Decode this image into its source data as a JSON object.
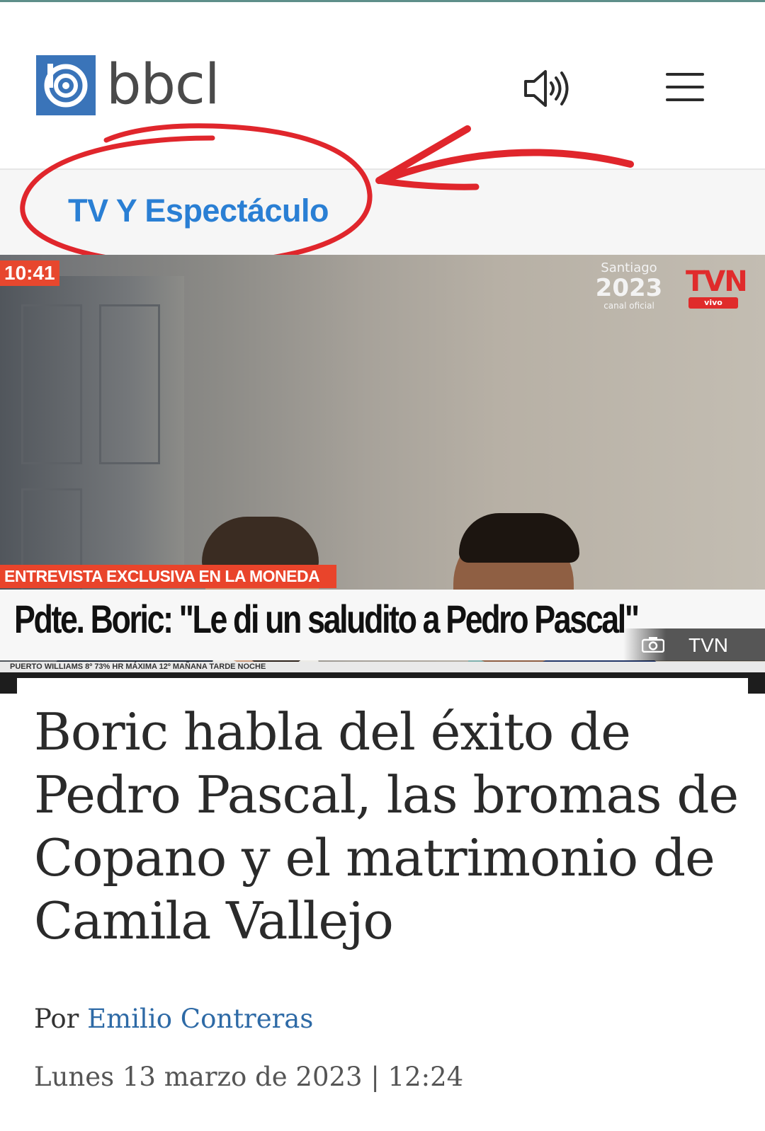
{
  "header": {
    "logo_text": "bbcl",
    "icons": [
      "logo-icon",
      "speaker-icon",
      "hamburger-icon"
    ]
  },
  "category": {
    "label": "TV Y Espectáculo"
  },
  "hero": {
    "time": "10:41",
    "event_top": "Santiago",
    "event_year": "2023",
    "event_sub": "canal oficial",
    "channel": "TVN",
    "channel_live": "vivo",
    "exclusive_label": "ENTREVISTA EXCLUSIVA EN LA MONEDA",
    "lower_third": "Pdte. Boric: \"Le di un saludito a Pedro Pascal\"",
    "ticker": "PUERTO WILLIAMS      8º   73% HR   MÁXIMA   12º   MAÑANA      TARDE      NOCHE",
    "photo_credit": "TVN"
  },
  "article": {
    "headline": "Boric habla del éxito de Pedro Pascal, las bromas de Copano y el matrimonio de Camila Vallejo",
    "byline_prefix": "Por",
    "author": "Emilio Contreras",
    "date": "Lunes 13 marzo de 2023 | 12:24"
  },
  "colors": {
    "logo_blue": "#3a74b9",
    "category_blue": "#2a7fd4",
    "annotation_red": "#e0262c",
    "author_link": "#2e6aa6"
  }
}
